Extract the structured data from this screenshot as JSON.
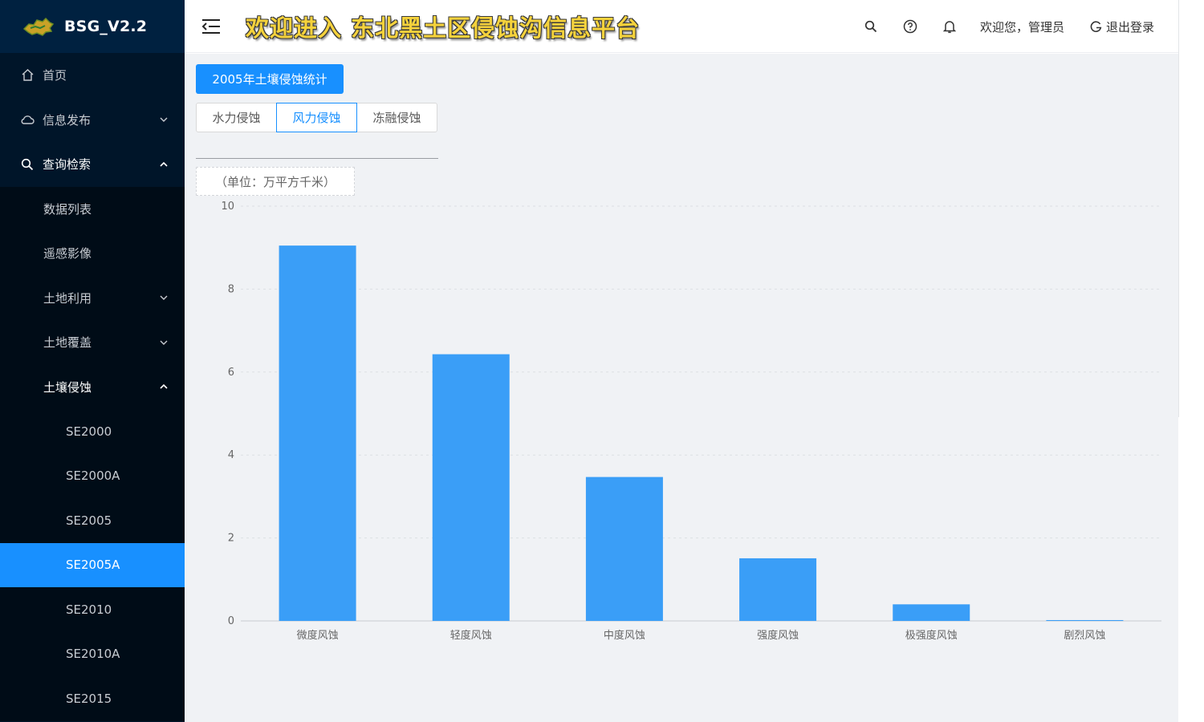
{
  "app": {
    "name": "BSG_V2.2"
  },
  "header": {
    "title": "欢迎进入 东北黑土区侵蚀沟信息平台",
    "welcome": "欢迎您，管理员",
    "logout": "退出登录"
  },
  "sidebar": {
    "home": "首页",
    "info": "信息发布",
    "query": "查询检索",
    "data_list": "数据列表",
    "remote": "遥感影像",
    "land_use": "土地利用",
    "land_cover": "土地覆盖",
    "soil_erosion": "土壤侵蚀",
    "subitems": [
      "SE2000",
      "SE2000A",
      "SE2005",
      "SE2005A",
      "SE2010",
      "SE2010A",
      "SE2015"
    ]
  },
  "main": {
    "stat_button": "2005年土壤侵蚀统计",
    "tabs": [
      "水力侵蚀",
      "风力侵蚀",
      "冻融侵蚀"
    ],
    "selected_tab": "风力侵蚀",
    "unit": "（单位：万平方千米）"
  },
  "colors": {
    "accent": "#1890ff",
    "bar": "#3a9ef7",
    "sidebar_bg": "#001529"
  },
  "chart_data": {
    "type": "bar",
    "categories": [
      "微度风蚀",
      "轻度风蚀",
      "中度风蚀",
      "强度风蚀",
      "极强度风蚀",
      "剧烈风蚀"
    ],
    "values": [
      9.05,
      6.43,
      3.47,
      1.51,
      0.4,
      0.02
    ],
    "ylim": [
      0,
      10
    ],
    "yticks": [
      0,
      2,
      4,
      6,
      8,
      10
    ],
    "grid": true
  }
}
